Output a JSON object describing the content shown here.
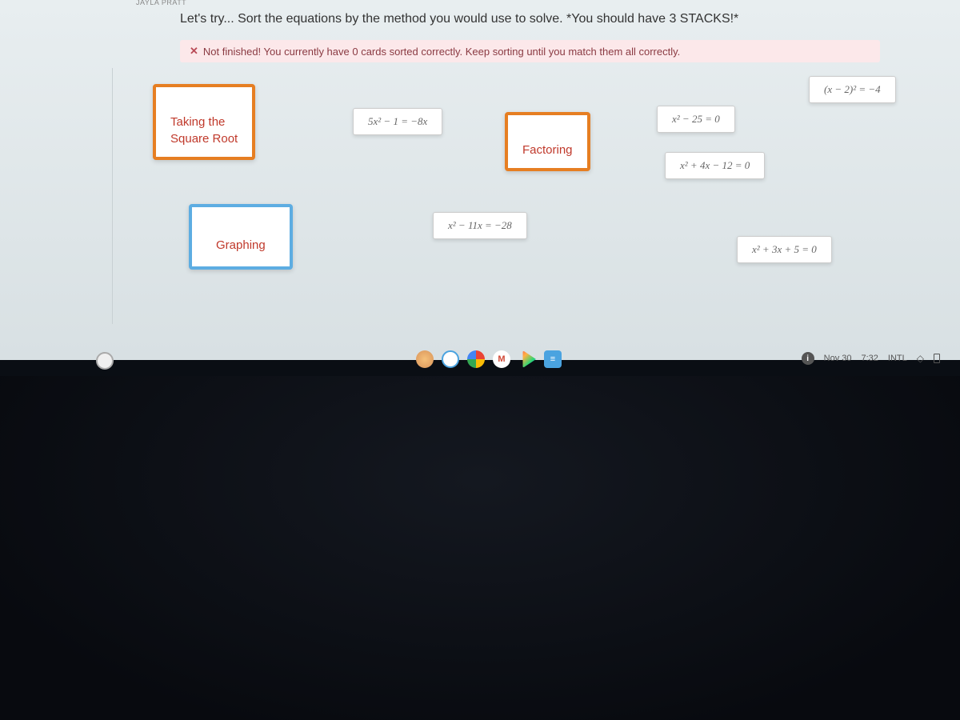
{
  "browser": {
    "tab_label": "JAYLA PRATT"
  },
  "instruction": "Let's try... Sort the equations by the method you would use to solve. *You should have 3 STACKS!*",
  "status": {
    "icon": "✕",
    "text": "Not finished! You currently have 0 cards sorted correctly. Keep sorting until you match them all correctly."
  },
  "categories": {
    "sqrt": "Taking the\nSquare Root",
    "factoring": "Factoring",
    "graphing": "Graphing"
  },
  "equations": {
    "eq1": "5x² − 1 = −8x",
    "eq2": "x² − 25 = 0",
    "eq3": "(x − 2)² = −4",
    "eq4": "x² + 4x − 12 = 0",
    "eq5": "x² − 11x = −28",
    "eq6": "x² + 3x + 5 = 0"
  },
  "taskbar": {
    "gmail": "M"
  },
  "systray": {
    "date": "Nov 30",
    "time": "7:32",
    "lang": "INTL"
  }
}
